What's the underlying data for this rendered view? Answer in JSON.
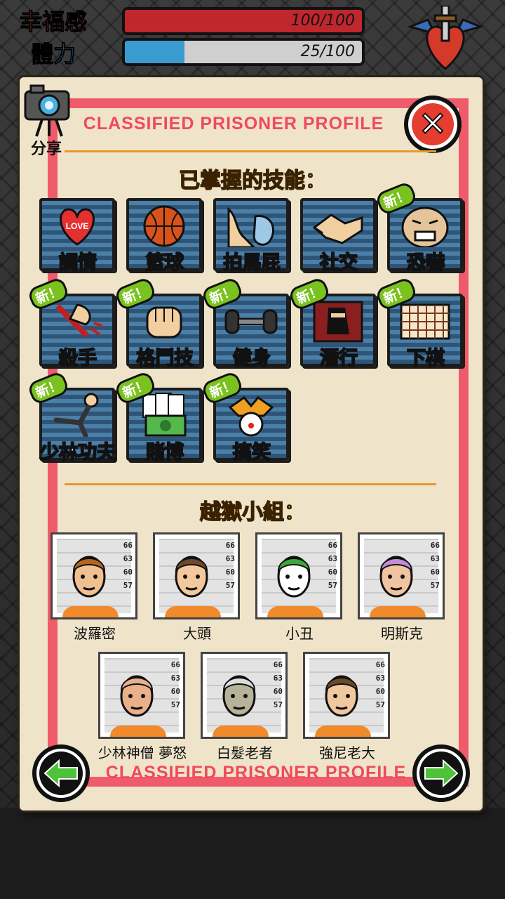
{
  "hud": {
    "happiness_label": "幸福感",
    "happiness_value": "100/100",
    "happiness_fraction": 1.0,
    "stamina_label": "體力",
    "stamina_value": "25/100",
    "stamina_fraction": 0.25
  },
  "share": {
    "label": "分享"
  },
  "profile": {
    "title_top": "CLASSIFIED PRISONER PROFILE",
    "title_bottom": "CLASSIFIED PRISONER PROFILE"
  },
  "skills": {
    "heading": "已掌握的技能：",
    "items": [
      {
        "label": "調情",
        "icon": "love-heart-icon",
        "new": false
      },
      {
        "label": "籃球",
        "icon": "basketball-icon",
        "new": false
      },
      {
        "label": "拍馬屁",
        "icon": "kiss-butt-icon",
        "new": false
      },
      {
        "label": "社交",
        "icon": "handshake-icon",
        "new": false
      },
      {
        "label": "恐嚇",
        "icon": "angry-face-icon",
        "new": true
      },
      {
        "label": "殺手",
        "icon": "knife-hand-icon",
        "new": true
      },
      {
        "label": "格鬥技",
        "icon": "fist-icon",
        "new": true
      },
      {
        "label": "健身",
        "icon": "dumbbell-icon",
        "new": true
      },
      {
        "label": "潛行",
        "icon": "ninja-icon",
        "new": true
      },
      {
        "label": "下棋",
        "icon": "chessboard-icon",
        "new": true
      },
      {
        "label": "少林功夫",
        "icon": "kungfu-kick-icon",
        "new": true
      },
      {
        "label": "賭博",
        "icon": "cards-money-icon",
        "new": true
      },
      {
        "label": "搞笑",
        "icon": "jester-icon",
        "new": true
      }
    ],
    "new_badge_text": "新！"
  },
  "crew": {
    "heading": "越獄小組：",
    "ruler_numbers": [
      "66",
      "63",
      "60",
      "57"
    ],
    "members": [
      {
        "name": "波羅密",
        "hair": "#b5651d",
        "skin": "#f0c090"
      },
      {
        "name": "大頭",
        "hair": "#6b4a2a",
        "skin": "#f3c89a"
      },
      {
        "name": "小丑",
        "hair": "#3aa83a",
        "skin": "#ffffff"
      },
      {
        "name": "明斯克",
        "hair": "#c58ad8",
        "skin": "#f0c4a0"
      },
      {
        "name": "少林神僧 夢怒",
        "hair": "#e8b090",
        "skin": "#eab08a"
      },
      {
        "name": "白髮老者",
        "hair": "#dddddd",
        "skin": "#b7b39a"
      },
      {
        "name": "強尼老大",
        "hair": "#6b4a2a",
        "skin": "#f0c8a0"
      }
    ]
  },
  "colors": {
    "frame": "#ef5b6a",
    "happiness_bar": "#c0272d",
    "stamina_bar": "#3a9bd0",
    "heading": "#f2b43a",
    "nav_arrow": "#4ec33a"
  }
}
